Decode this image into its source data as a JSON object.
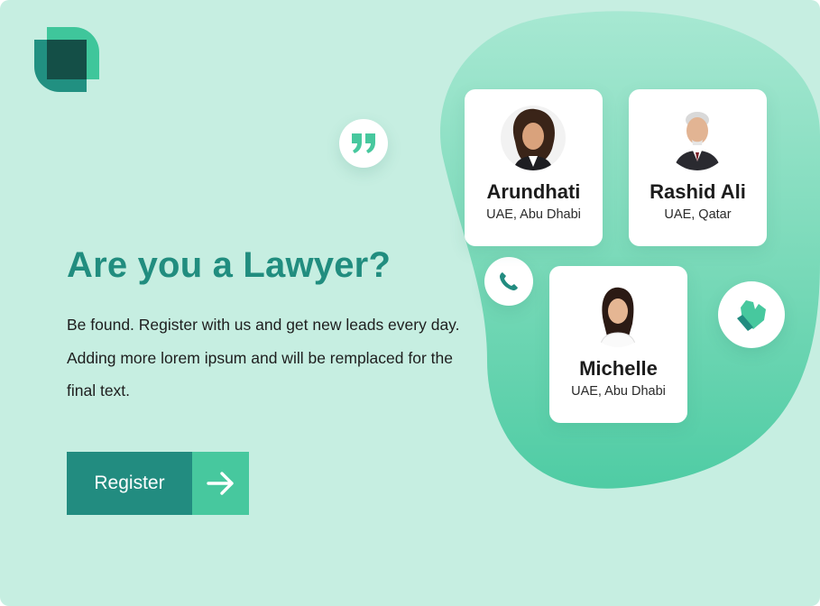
{
  "hero": {
    "headline": "Are you a Lawyer?",
    "description": "Be found. Register with us and get new leads every day. Adding more lorem ipsum and will be remplaced for the final text.",
    "register_label": "Register"
  },
  "lawyers": [
    {
      "name": "Arundhati",
      "location": "UAE, Abu Dhabi"
    },
    {
      "name": "Rashid Ali",
      "location": "UAE, Qatar"
    },
    {
      "name": "Michelle",
      "location": "UAE, Abu Dhabi"
    }
  ],
  "icons": {
    "logo": "logo-icon",
    "quote": "quote-icon",
    "phone": "phone-icon",
    "handshake": "handshake-icon",
    "arrow": "arrow-right-icon"
  },
  "colors": {
    "background": "#c6eee1",
    "accent_dark": "#218d7f",
    "accent_light": "#47c89e",
    "button_dark": "#228c80"
  }
}
